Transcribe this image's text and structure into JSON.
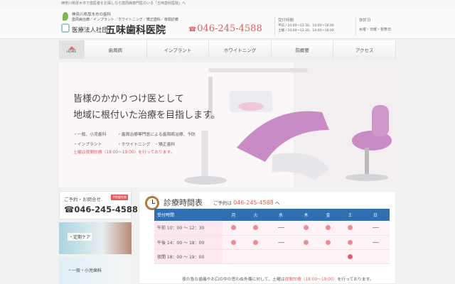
{
  "top_strip": "神奈川県厚木市で歯医者をお探しなら歯周病専門医のいる「五味歯科医院」へ",
  "header": {
    "tagline1": "神奈川県厚木市の歯科",
    "tagline2": "歯周病治療／インプラント／ホワイトニング／矯正歯科／夜間診療",
    "clinic_prefix": "医療法人社団",
    "clinic_name": "五味歯科医院",
    "phone": "046-245-4588",
    "hours_title": "受付時間",
    "hours_row1": "平日 / 10:00〜12:30、14:00〜18:00",
    "hours_row2": "土曜 / 10:00〜12:30、14:00〜18:00",
    "closed_title": "休診日",
    "closed_days": "水曜・日曜・祝祭日"
  },
  "nav": {
    "home": "HOME",
    "items": [
      "歯周病",
      "インプラント",
      "ホワイトニング",
      "院概要",
      "アクセス"
    ]
  },
  "hero": {
    "title_line1": "皆様のかかりつけ医として",
    "title_line2": "地域に根付いた治療を目指します。",
    "list": [
      [
        "・一般、小児歯科",
        "・歯周治療専門医による歯周病治療、予防"
      ],
      [
        "・インプラント",
        "・ホワイトニング　・矯正歯科"
      ]
    ],
    "note": "土曜は夜間診療（18:00〜19:00）を行っております。"
  },
  "sidebar": {
    "contact_label": "ご予約・お問合せ",
    "contact_badge": "予約優先制",
    "contact_phone": "046-245-4588",
    "banner1": "・定期ケア",
    "banner2": "・一般・小児歯科"
  },
  "schedule": {
    "title": "診療時間表",
    "reserve_prefix": "ご予約は",
    "reserve_phone": "046-245-4588",
    "reserve_suffix": "へ",
    "header": [
      "受付時間",
      "月",
      "火",
      "水",
      "木",
      "金",
      "土",
      "日"
    ],
    "rows": [
      {
        "label": "午前 10：00 〜 12：30",
        "cells": [
          "dot",
          "dot",
          "dash",
          "dot",
          "dot",
          "dot",
          "dash"
        ]
      },
      {
        "label": "午後 14：00 〜 18：00",
        "cells": [
          "dot",
          "dot",
          "dash",
          "dot",
          "dot",
          "dot",
          "dash"
        ]
      },
      {
        "label": "夜間 18：00 〜 19：00",
        "cells": [
          "",
          "",
          "",
          "",
          "",
          "filled",
          ""
        ]
      }
    ],
    "note_prefix": "夜の急な歯痛やお口の中の思わぬ外傷に対して、土曜は",
    "note_red": "夜間診療（18:00〜19:00）",
    "note_suffix": "を行っております。"
  },
  "colors": {
    "accent": "#e05c5c",
    "table_header": "#2f6fb2",
    "dot": "#ee8a95"
  }
}
